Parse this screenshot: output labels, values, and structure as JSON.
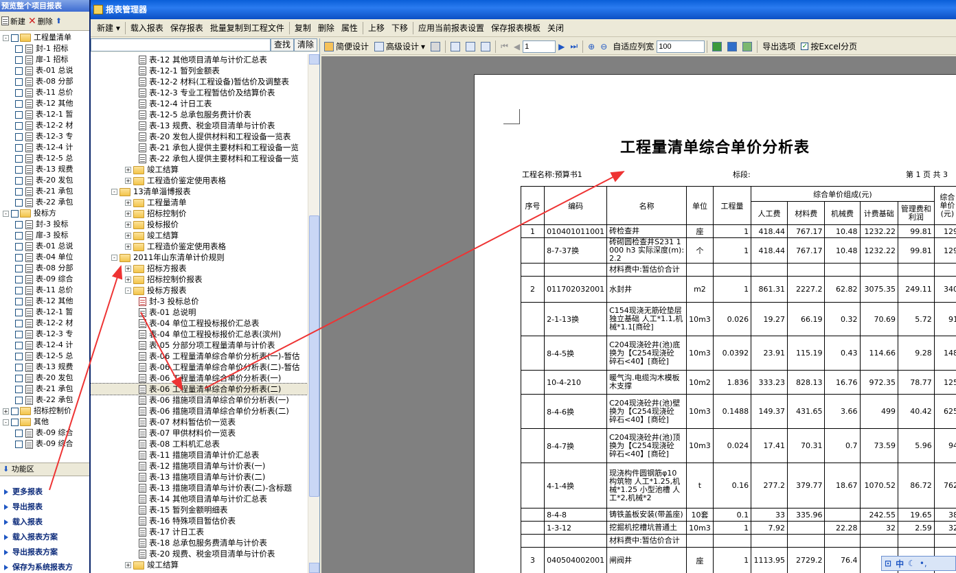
{
  "back_window": {
    "title": "预览整个项目报表",
    "toolbar": {
      "new": "新建",
      "delete": "删除"
    },
    "tree": [
      {
        "kind": "folder",
        "label": "工程量清单",
        "level": 1,
        "exp": "-"
      },
      {
        "kind": "doc",
        "label": "封-1 招标",
        "level": 2
      },
      {
        "kind": "doc",
        "label": "扉-1 招标",
        "level": 2
      },
      {
        "kind": "doc",
        "label": "表-01 总说",
        "level": 2
      },
      {
        "kind": "doc",
        "label": "表-08 分部",
        "level": 2
      },
      {
        "kind": "doc",
        "label": "表-11 总价",
        "level": 2
      },
      {
        "kind": "doc",
        "label": "表-12 其他",
        "level": 2
      },
      {
        "kind": "doc",
        "label": "表-12-1 暂",
        "level": 2
      },
      {
        "kind": "doc",
        "label": "表-12-2 材",
        "level": 2
      },
      {
        "kind": "doc",
        "label": "表-12-3 专",
        "level": 2
      },
      {
        "kind": "doc",
        "label": "表-12-4 计",
        "level": 2
      },
      {
        "kind": "doc",
        "label": "表-12-5 总",
        "level": 2
      },
      {
        "kind": "doc",
        "label": "表-13 规费",
        "level": 2
      },
      {
        "kind": "doc",
        "label": "表-20 发包",
        "level": 2
      },
      {
        "kind": "doc",
        "label": "表-21 承包",
        "level": 2
      },
      {
        "kind": "doc",
        "label": "表-22 承包",
        "level": 2
      },
      {
        "kind": "folder",
        "label": "投标方",
        "level": 1,
        "exp": "-"
      },
      {
        "kind": "doc",
        "label": "封-3 投标",
        "level": 2
      },
      {
        "kind": "doc",
        "label": "扉-3 投标",
        "level": 2
      },
      {
        "kind": "doc",
        "label": "表-01 总说",
        "level": 2
      },
      {
        "kind": "doc",
        "label": "表-04 单位",
        "level": 2
      },
      {
        "kind": "doc",
        "label": "表-08 分部",
        "level": 2
      },
      {
        "kind": "doc",
        "label": "表-09 综合",
        "level": 2
      },
      {
        "kind": "doc",
        "label": "表-11 总价",
        "level": 2
      },
      {
        "kind": "doc",
        "label": "表-12 其他",
        "level": 2
      },
      {
        "kind": "doc",
        "label": "表-12-1 暂",
        "level": 2
      },
      {
        "kind": "doc",
        "label": "表-12-2 材",
        "level": 2
      },
      {
        "kind": "doc",
        "label": "表-12-3 专",
        "level": 2
      },
      {
        "kind": "doc",
        "label": "表-12-4 计",
        "level": 2
      },
      {
        "kind": "doc",
        "label": "表-12-5 总",
        "level": 2
      },
      {
        "kind": "doc",
        "label": "表-13 规费",
        "level": 2
      },
      {
        "kind": "doc",
        "label": "表-20 发包",
        "level": 2
      },
      {
        "kind": "doc",
        "label": "表-21 承包",
        "level": 2
      },
      {
        "kind": "doc",
        "label": "表-22 承包",
        "level": 2
      },
      {
        "kind": "folder",
        "label": "招标控制价",
        "level": 1,
        "exp": "+"
      },
      {
        "kind": "folder",
        "label": "其他",
        "level": 1,
        "exp": "-"
      },
      {
        "kind": "doc",
        "label": "表-09 综合",
        "level": 2
      },
      {
        "kind": "doc",
        "label": "表-09 综合",
        "level": 2
      }
    ],
    "func_area": "功能区",
    "func_items": [
      "更多报表",
      "导出报表",
      "载入报表",
      "载入报表方案",
      "导出报表方案",
      "保存为系统报表方"
    ]
  },
  "main_window": {
    "title": "报表管理器",
    "menu": [
      "新建",
      "载入报表",
      "保存报表",
      "批量复制到工程文件",
      "复制",
      "删除",
      "属性",
      "上移",
      "下移",
      "应用当前报表设置",
      "保存报表模板",
      "关闭"
    ],
    "search_placeholder": "",
    "search_btn": "查找",
    "clear_btn": "清除",
    "tree": [
      {
        "kind": "doc",
        "label": "表-12 其他项目清单与计价汇总表",
        "level": 3
      },
      {
        "kind": "doc",
        "label": "表-12-1 暂列金额表",
        "level": 3
      },
      {
        "kind": "doc",
        "label": "表-12-2 材料(工程设备)暂估价及调整表",
        "level": 3
      },
      {
        "kind": "doc",
        "label": "表-12-3 专业工程暂估价及结算价表",
        "level": 3
      },
      {
        "kind": "doc",
        "label": "表-12-4 计日工表",
        "level": 3
      },
      {
        "kind": "doc",
        "label": "表-12-5 总承包服务费计价表",
        "level": 3
      },
      {
        "kind": "doc",
        "label": "表-13 规费、税金项目清单与计价表",
        "level": 3
      },
      {
        "kind": "doc",
        "label": "表-20 发包人提供材料和工程设备一览表",
        "level": 3
      },
      {
        "kind": "doc",
        "label": "表-21 承包人提供主要材料和工程设备一览",
        "level": 3
      },
      {
        "kind": "doc",
        "label": "表-22 承包人提供主要材料和工程设备一览",
        "level": 3
      },
      {
        "kind": "folder",
        "label": "竣工结算",
        "level": 2,
        "exp": "+"
      },
      {
        "kind": "folder",
        "label": "工程造价鉴定使用表格",
        "level": 2,
        "exp": "+"
      },
      {
        "kind": "folder",
        "label": "13清单淄博报表",
        "level": 1,
        "exp": "-"
      },
      {
        "kind": "folder",
        "label": "工程量清单",
        "level": 2,
        "exp": "+"
      },
      {
        "kind": "folder",
        "label": "招标控制价",
        "level": 2,
        "exp": "+"
      },
      {
        "kind": "folder",
        "label": "投标报价",
        "level": 2,
        "exp": "+"
      },
      {
        "kind": "folder",
        "label": "竣工结算",
        "level": 2,
        "exp": "+"
      },
      {
        "kind": "folder",
        "label": "工程造价鉴定使用表格",
        "level": 2,
        "exp": "+"
      },
      {
        "kind": "folder",
        "label": "2011年山东清单计价规则",
        "level": 1,
        "exp": "-"
      },
      {
        "kind": "folder",
        "label": "招标方报表",
        "level": 2,
        "exp": "+"
      },
      {
        "kind": "folder",
        "label": "招标控制价报表",
        "level": 2,
        "exp": "+"
      },
      {
        "kind": "folder",
        "label": "投标方报表",
        "level": 2,
        "exp": "-"
      },
      {
        "kind": "docr",
        "label": "封-3 投标总价",
        "level": 3
      },
      {
        "kind": "doc",
        "label": "表-01 总说明",
        "level": 3
      },
      {
        "kind": "doc",
        "label": "表-04 单位工程投标报价汇总表",
        "level": 3
      },
      {
        "kind": "doc",
        "label": "表-04 单位工程投标报价汇总表(滨州)",
        "level": 3
      },
      {
        "kind": "doc",
        "label": "表-05 分部分项工程量清单与计价表",
        "level": 3
      },
      {
        "kind": "doc",
        "label": "表-06 工程量清单综合单价分析表(一)-暂估",
        "level": 3
      },
      {
        "kind": "doc",
        "label": "表-06 工程量清单综合单价分析表(二)-暂估",
        "level": 3
      },
      {
        "kind": "doc",
        "label": "表-06 工程量清单综合单价分析表(一)",
        "level": 3
      },
      {
        "kind": "doc",
        "label": "表-06 工程量清单综合单价分析表(二)",
        "level": 3,
        "selected": true
      },
      {
        "kind": "doc",
        "label": "表-06 措施项目清单综合单价分析表(一)",
        "level": 3
      },
      {
        "kind": "doc",
        "label": "表-06 措施项目清单综合单价分析表(二)",
        "level": 3
      },
      {
        "kind": "doc",
        "label": "表-07 材料暂估价一览表",
        "level": 3
      },
      {
        "kind": "doc",
        "label": "表-07 甲供材料价一览表",
        "level": 3
      },
      {
        "kind": "doc",
        "label": "表-08 工料机汇总表",
        "level": 3
      },
      {
        "kind": "doc",
        "label": "表-11 措施项目清单计价汇总表",
        "level": 3
      },
      {
        "kind": "doc",
        "label": "表-12 措施项目清单与计价表(一)",
        "level": 3
      },
      {
        "kind": "doc",
        "label": "表-13 措施项目清单与计价表(二)",
        "level": 3
      },
      {
        "kind": "doc",
        "label": "表-13 措施项目清单与计价表(二)-含标题",
        "level": 3
      },
      {
        "kind": "doc",
        "label": "表-14 其他项目清单与计价汇总表",
        "level": 3
      },
      {
        "kind": "doc",
        "label": "表-15 暂列金额明细表",
        "level": 3
      },
      {
        "kind": "doc",
        "label": "表-16 特殊项目暂估价表",
        "level": 3
      },
      {
        "kind": "doc",
        "label": "表-17 计日工表",
        "level": 3
      },
      {
        "kind": "doc",
        "label": "表-18 总承包服务费清单与计价表",
        "level": 3
      },
      {
        "kind": "doc",
        "label": "表-20 规费、税金项目清单与计价表",
        "level": 3
      },
      {
        "kind": "folder",
        "label": "竣工结算",
        "level": 2,
        "exp": "+"
      }
    ],
    "toolbar2": {
      "simple_design": "简便设计",
      "advanced_design": "高级设计",
      "page_input": "1",
      "fit_width": "自适应列宽",
      "zoom": "100",
      "export_options": "导出选项",
      "excel_split": "按Excel分页"
    }
  },
  "report": {
    "title": "工程量清单综合单价分析表",
    "project_label": "工程名称:预算书1",
    "section_label": "标段:",
    "page_label": "第 1 页  共 3",
    "headers": {
      "seq": "序号",
      "code": "编码",
      "name": "名称",
      "unit": "单位",
      "qty": "工程量",
      "group": "综合单价组成(元)",
      "labor": "人工费",
      "material": "材料费",
      "machine": "机械费",
      "base": "计费基础",
      "mgmt": "管理费和利润",
      "total": "综合单价(元)"
    },
    "rows": [
      {
        "seq": "1",
        "code": "010401011001",
        "name": "砖检查井",
        "unit": "座",
        "qty": "1",
        "labor": "418.44",
        "material": "767.17",
        "machine": "10.48",
        "base": "1232.22",
        "mgmt": "99.81",
        "total": "129",
        "h": 19
      },
      {
        "seq": "",
        "code": "8-7-37换",
        "name": "砖砌圆检查井S231 1000 h3  实际深度(m):2.2",
        "unit": "个",
        "qty": "1",
        "labor": "418.44",
        "material": "767.17",
        "machine": "10.48",
        "base": "1232.22",
        "mgmt": "99.81",
        "total": "129",
        "h": 35
      },
      {
        "seq": "",
        "code": "",
        "name": "材料费中:暂估价合计",
        "unit": "",
        "qty": "",
        "labor": "",
        "material": "",
        "machine": "",
        "base": "",
        "mgmt": "",
        "total": "",
        "h": 19
      },
      {
        "seq": "2",
        "code": "011702032001",
        "name": "水封井",
        "unit": "m2",
        "qty": "1",
        "labor": "861.31",
        "material": "2227.2",
        "machine": "62.82",
        "base": "3075.35",
        "mgmt": "249.11",
        "total": "340",
        "h": 38
      },
      {
        "seq": "",
        "code": "2-1-13换",
        "name": "C154现浇无筋砼垫层 独立基础 人工*1.1,机械*1.1[商砼]",
        "unit": "10m3",
        "qty": "0.026",
        "labor": "19.27",
        "material": "66.19",
        "machine": "0.32",
        "base": "70.69",
        "mgmt": "5.72",
        "total": "91",
        "h": 49
      },
      {
        "seq": "",
        "code": "8-4-5换",
        "name": "C204现浇砼井(池)底 换为【C254现浇砼 碎石<40】[商砼]",
        "unit": "10m3",
        "qty": "0.0392",
        "labor": "23.91",
        "material": "115.19",
        "machine": "0.43",
        "base": "114.66",
        "mgmt": "9.28",
        "total": "148",
        "h": 50
      },
      {
        "seq": "",
        "code": "10-4-210",
        "name": "暖气沟.电缆沟木模板木支撑",
        "unit": "10m2",
        "qty": "1.836",
        "labor": "333.23",
        "material": "828.13",
        "machine": "16.76",
        "base": "972.35",
        "mgmt": "78.77",
        "total": "125",
        "h": 35
      },
      {
        "seq": "",
        "code": "8-4-6换",
        "name": "C204现浇砼井(池)壁 换为【C254现浇砼 碎石<40】[商砼]",
        "unit": "10m3",
        "qty": "0.1488",
        "labor": "149.37",
        "material": "431.65",
        "machine": "3.66",
        "base": "499",
        "mgmt": "40.42",
        "total": "625",
        "h": 50
      },
      {
        "seq": "",
        "code": "8-4-7换",
        "name": "C204现浇砼井(池)顶 换为【C254现浇砼 碎石<40】[商砼]",
        "unit": "10m3",
        "qty": "0.024",
        "labor": "17.41",
        "material": "70.31",
        "machine": "0.7",
        "base": "73.59",
        "mgmt": "5.96",
        "total": "94",
        "h": 50
      },
      {
        "seq": "",
        "code": "4-1-4换",
        "name": "现浇构件圆钢筋φ10 构筑物 人工*1.25,机械*1.25 小型池槽 人工*2,机械*2",
        "unit": "t",
        "qty": "0.16",
        "labor": "277.2",
        "material": "379.77",
        "machine": "18.67",
        "base": "1070.52",
        "mgmt": "86.72",
        "total": "762",
        "h": 66
      },
      {
        "seq": "",
        "code": "8-4-8",
        "name": "铸铁盖板安装(带盖座)",
        "unit": "10套",
        "qty": "0.1",
        "labor": "33",
        "material": "335.96",
        "machine": "",
        "base": "242.55",
        "mgmt": "19.65",
        "total": "38",
        "h": 19
      },
      {
        "seq": "",
        "code": "1-3-12",
        "name": "挖掘机挖槽坑普通土",
        "unit": "10m3",
        "qty": "1",
        "labor": "7.92",
        "material": "",
        "machine": "22.28",
        "base": "32",
        "mgmt": "2.59",
        "total": "32",
        "h": 19
      },
      {
        "seq": "",
        "code": "",
        "name": "材料费中:暂估价合计",
        "unit": "",
        "qty": "",
        "labor": "",
        "material": "",
        "machine": "",
        "base": "",
        "mgmt": "",
        "total": "",
        "h": 19
      },
      {
        "seq": "3",
        "code": "040504002001",
        "name": "闸阀井",
        "unit": "座",
        "qty": "1",
        "labor": "1113.95",
        "material": "2729.2",
        "machine": "76.4",
        "base": "39",
        "mgmt": "",
        "total": "",
        "h": 38
      }
    ]
  },
  "ime": {
    "lang": "中"
  }
}
